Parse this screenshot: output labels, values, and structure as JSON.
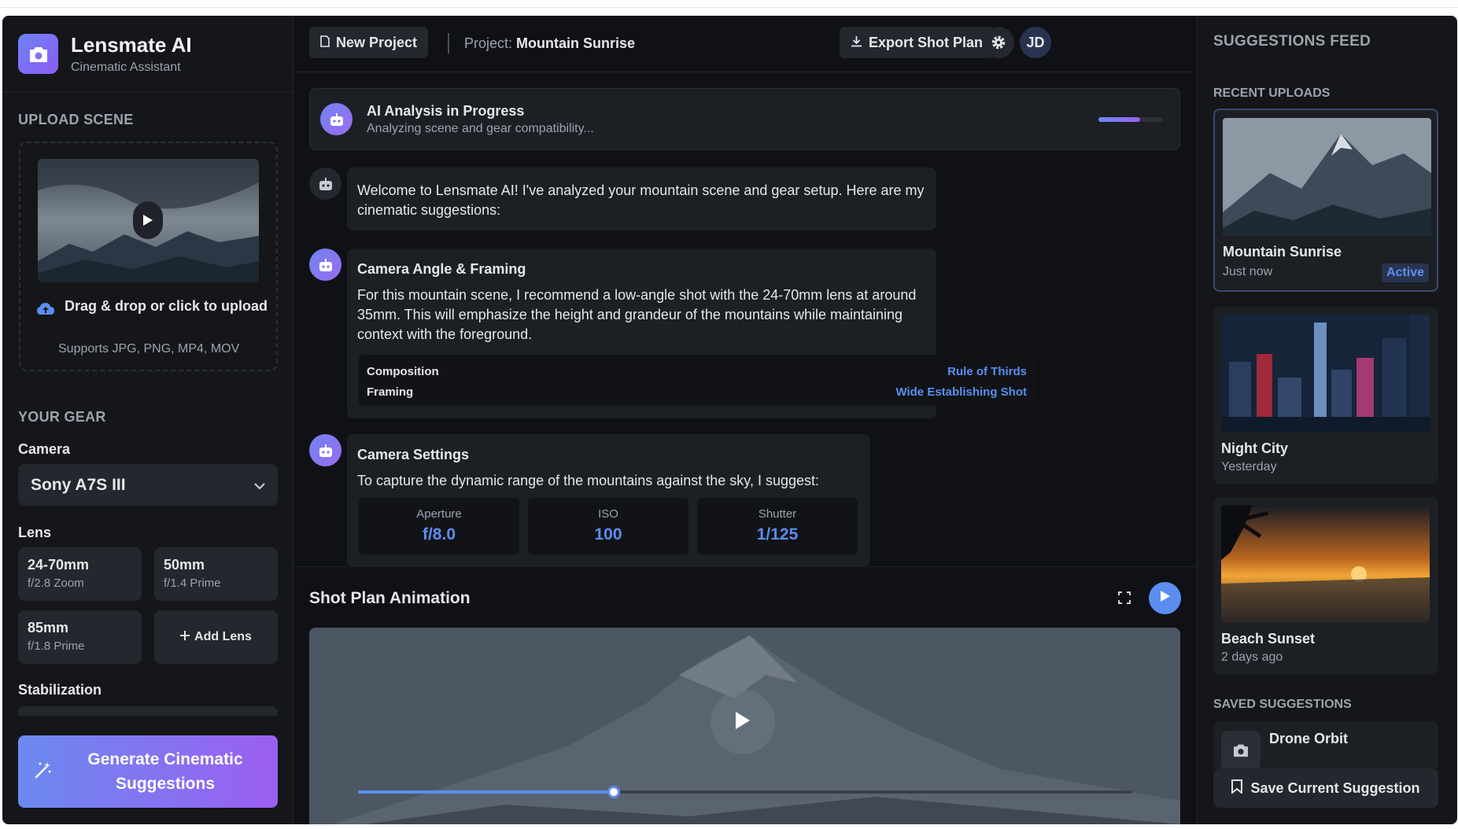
{
  "brand": {
    "title": "Lensmate AI",
    "subtitle": "Cinematic Assistant"
  },
  "sidebar": {
    "upload_title": "UPLOAD SCENE",
    "upload_cta": "Drag & drop or click to upload",
    "upload_hint": "Supports JPG, PNG, MP4, MOV",
    "gear_title": "YOUR GEAR",
    "camera_label": "Camera",
    "camera_value": "Sony A7S III",
    "lens_label": "Lens",
    "lenses": [
      {
        "name": "24-70mm",
        "spec": "f/2.8 Zoom"
      },
      {
        "name": "50mm",
        "spec": "f/1.4 Prime"
      },
      {
        "name": "85mm",
        "spec": "f/1.8 Prime"
      }
    ],
    "add_lens": "Add Lens",
    "stabilization_label": "Stabilization",
    "generate_label": "Generate Cinematic Suggestions"
  },
  "header": {
    "new_project": "New Project",
    "project_prefix": "Project:",
    "project_name": "Mountain Sunrise",
    "export": "Export Shot Plan",
    "avatar": "JD"
  },
  "analysis": {
    "title": "AI Analysis in Progress",
    "subtitle": "Analyzing scene and gear compatibility...",
    "progress": 0.65
  },
  "messages": {
    "welcome": "Welcome to Lensmate AI! I've analyzed your mountain scene and gear setup. Here are my cinematic suggestions:",
    "angle": {
      "title": "Camera Angle & Framing",
      "text": "For this mountain scene, I recommend a low-angle shot with the 24-70mm lens at around 35mm. This will emphasize the height and grandeur of the mountains while maintaining context with the foreground.",
      "composition_label": "Composition",
      "composition_value": "Rule of Thirds",
      "framing_label": "Framing",
      "framing_value": "Wide Establishing Shot"
    },
    "settings": {
      "title": "Camera Settings",
      "text": "To capture the dynamic range of the mountains against the sky, I suggest:",
      "aperture_label": "Aperture",
      "aperture_value": "f/8.0",
      "iso_label": "ISO",
      "iso_value": "100",
      "shutter_label": "Shutter",
      "shutter_value": "1/125"
    }
  },
  "animation": {
    "title": "Shot Plan Animation",
    "progress": 0.33
  },
  "feed": {
    "title": "SUGGESTIONS FEED",
    "recent_title": "RECENT UPLOADS",
    "uploads": [
      {
        "name": "Mountain Sunrise",
        "time": "Just now",
        "badge": "Active"
      },
      {
        "name": "Night City",
        "time": "Yesterday"
      },
      {
        "name": "Beach Sunset",
        "time": "2 days ago"
      }
    ],
    "saved_title": "SAVED SUGGESTIONS",
    "saved_items": [
      {
        "name": "Drone Orbit"
      }
    ],
    "save_button": "Save Current Suggestion"
  },
  "colors": {
    "accent": "#5b8ef0",
    "gradient_start": "#6b8af0",
    "gradient_end": "#9b5ff0",
    "background": "#0f1115"
  },
  "icons": [
    "camera-icon",
    "play-icon",
    "cloud-upload-icon",
    "chevron-down-icon",
    "plus-icon",
    "magic-wand-icon",
    "file-icon",
    "download-icon",
    "gear-icon",
    "robot-icon",
    "fullscreen-icon",
    "bookmark-icon"
  ]
}
